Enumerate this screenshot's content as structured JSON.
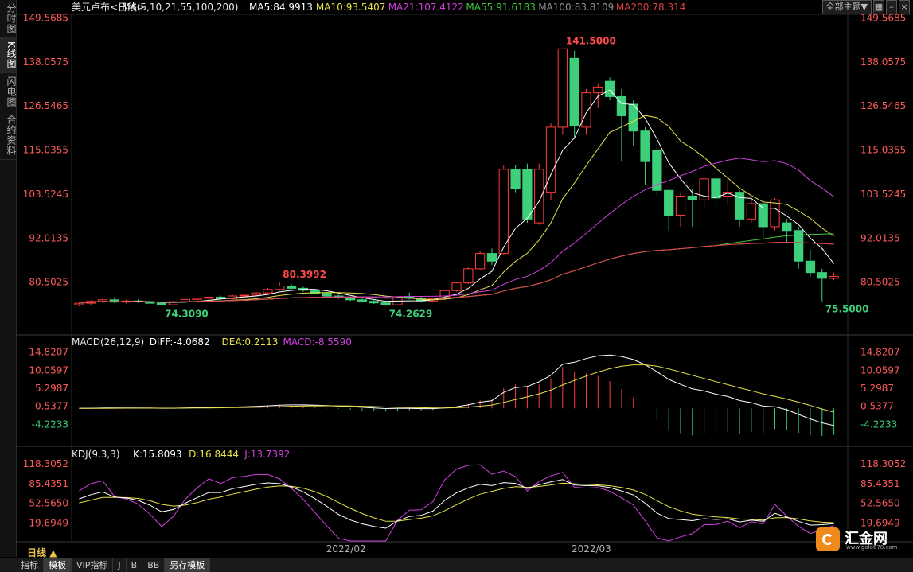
{
  "sidebar": {
    "tabs": [
      {
        "label": "分时图",
        "active": false
      },
      {
        "label": "K线图",
        "active": true
      },
      {
        "label": "闪电图",
        "active": false
      },
      {
        "label": "合约资料",
        "active": false
      }
    ]
  },
  "topbar": {
    "theme_button": "全部主题▼",
    "icons": [
      "grid-icon",
      "minimize-icon",
      "close-icon"
    ]
  },
  "colors": {
    "up": "#ff3b3b",
    "down": "#3cd07a",
    "ma5": "#ffffff",
    "ma10": "#e8e14a",
    "ma21": "#d040e0",
    "ma55": "#3ec83e",
    "ma100": "#909090",
    "ma200": "#e04040",
    "price_axis": "#ff5a5a",
    "neg_axis": "#3cd07a"
  },
  "bottom": {
    "period": "日线",
    "tabs": [
      "指标",
      "模板",
      "VIP指标",
      "J",
      "B",
      "BB",
      "另存模板"
    ],
    "active": [
      "模板",
      "另存模板"
    ]
  },
  "logo": {
    "name": "汇金网",
    "url": "www.gold678.com"
  },
  "chart_data": [
    {
      "type": "candlestick",
      "title": "美元卢布<日线>",
      "legend": [
        {
          "text": "美元卢布<日线>",
          "color": "#e8e8e8"
        },
        {
          "text": "MA(5,10,21,55,100,200)",
          "color": "#e8e8e8"
        },
        {
          "text": "MA5:84.9913",
          "color": "#ffffff"
        },
        {
          "text": "MA10:93.5407",
          "color": "#e8e14a"
        },
        {
          "text": "MA21:107.4122",
          "color": "#d040e0"
        },
        {
          "text": "MA55:91.6183",
          "color": "#3ec83e"
        },
        {
          "text": "MA100:83.8109",
          "color": "#909090"
        },
        {
          "text": "MA200:78.314",
          "color": "#e04040"
        }
      ],
      "y_ticks": [
        "149.5685",
        "138.0575",
        "126.5465",
        "115.0355",
        "103.5245",
        "92.0135",
        "80.5025"
      ],
      "ylim": [
        69.0,
        150.5
      ],
      "annotations": [
        {
          "text": "80.3992",
          "value": 80.3992,
          "color": "#ff4a4a"
        },
        {
          "text": "74.3090",
          "value": 74.309,
          "color": "#3cd07a"
        },
        {
          "text": "74.2629",
          "value": 74.2629,
          "color": "#3cd07a"
        },
        {
          "text": "141.5000",
          "value": 141.5,
          "color": "#ff4a4a"
        },
        {
          "text": "75.5000",
          "value": 75.5,
          "color": "#3cd07a"
        }
      ],
      "x_labels": [
        "2022/02",
        "2022/03"
      ],
      "candles": [
        [
          74.6,
          75.2,
          74.2,
          75.0
        ],
        [
          75.0,
          75.8,
          74.5,
          75.5
        ],
        [
          75.5,
          76.3,
          75.1,
          75.9
        ],
        [
          75.9,
          76.6,
          75.0,
          75.3
        ],
        [
          75.3,
          76.0,
          74.9,
          75.6
        ],
        [
          75.6,
          76.0,
          75.1,
          75.4
        ],
        [
          75.4,
          75.9,
          74.8,
          75.0
        ],
        [
          75.0,
          75.4,
          74.3,
          74.6
        ],
        [
          74.6,
          75.6,
          74.4,
          75.4
        ],
        [
          75.4,
          76.2,
          75.1,
          76.0
        ],
        [
          76.0,
          76.8,
          75.6,
          76.3
        ],
        [
          76.3,
          76.9,
          75.9,
          76.6
        ],
        [
          76.6,
          77.0,
          76.0,
          76.2
        ],
        [
          76.2,
          77.2,
          75.9,
          76.9
        ],
        [
          76.9,
          77.5,
          76.5,
          77.1
        ],
        [
          77.1,
          78.0,
          76.8,
          77.7
        ],
        [
          77.7,
          79.0,
          77.3,
          78.6
        ],
        [
          78.6,
          80.4,
          78.2,
          79.5
        ],
        [
          79.5,
          80.0,
          78.5,
          78.9
        ],
        [
          78.9,
          79.3,
          78.0,
          78.4
        ],
        [
          78.4,
          78.7,
          77.3,
          77.6
        ],
        [
          77.6,
          77.9,
          76.6,
          76.9
        ],
        [
          76.9,
          77.2,
          76.1,
          76.4
        ],
        [
          76.4,
          76.8,
          75.6,
          75.9
        ],
        [
          75.9,
          76.3,
          75.2,
          75.5
        ],
        [
          75.5,
          75.8,
          74.8,
          75.1
        ],
        [
          75.1,
          75.4,
          74.3,
          74.6
        ],
        [
          74.6,
          76.8,
          74.4,
          76.7
        ],
        [
          76.7,
          77.8,
          76.0,
          76.3
        ],
        [
          76.3,
          76.9,
          75.4,
          75.6
        ],
        [
          75.6,
          76.5,
          75.3,
          76.2
        ],
        [
          76.2,
          78.6,
          75.8,
          78.3
        ],
        [
          78.3,
          80.6,
          78.0,
          80.3
        ],
        [
          80.3,
          84.5,
          80.0,
          84.0
        ],
        [
          84.0,
          88.6,
          83.6,
          88.0
        ],
        [
          88.0,
          89.3,
          85.0,
          86.0
        ],
        [
          88.0,
          111.0,
          87.5,
          110.0
        ],
        [
          110.0,
          111.0,
          104.0,
          105.0
        ],
        [
          110.0,
          111.5,
          96.0,
          97.0
        ],
        [
          96.0,
          111.5,
          95.5,
          110.0
        ],
        [
          104.0,
          122.0,
          102.0,
          121.0
        ],
        [
          121.0,
          141.5,
          119.0,
          141.5
        ],
        [
          139.0,
          141.0,
          118.0,
          121.5
        ],
        [
          121.0,
          131.0,
          119.0,
          130.0
        ],
        [
          130.0,
          132.5,
          126.0,
          131.5
        ],
        [
          133.0,
          134.0,
          128.0,
          129.0
        ],
        [
          129.0,
          131.0,
          112.0,
          124.0
        ],
        [
          127.0,
          128.0,
          116.0,
          120.0
        ],
        [
          120.0,
          121.0,
          106.0,
          112.0
        ],
        [
          115.0,
          117.0,
          103.0,
          104.5
        ],
        [
          104.5,
          105.0,
          94.0,
          98.0
        ],
        [
          98.0,
          104.0,
          95.0,
          103.0
        ],
        [
          103.0,
          105.0,
          95.0,
          102.0
        ],
        [
          102.0,
          108.0,
          100.0,
          107.5
        ],
        [
          107.5,
          108.0,
          100.0,
          102.5
        ],
        [
          103.0,
          108.0,
          101.0,
          104.0
        ],
        [
          104.0,
          104.5,
          95.0,
          97.0
        ],
        [
          97.0,
          102.0,
          96.0,
          101.0
        ],
        [
          101.0,
          102.0,
          92.0,
          95.0
        ],
        [
          95.0,
          102.5,
          94.0,
          102.0
        ],
        [
          96.0,
          97.0,
          91.0,
          94.0
        ],
        [
          94.0,
          95.0,
          84.0,
          86.0
        ],
        [
          86.0,
          89.0,
          82.0,
          83.0
        ],
        [
          83.0,
          84.0,
          75.5,
          81.5
        ],
        [
          81.5,
          83.0,
          81.0,
          82.0
        ]
      ]
    },
    {
      "type": "line",
      "title": "MACD(26,12,9)",
      "legend": [
        {
          "text": "MACD(26,12,9)",
          "color": "#e8e8e8"
        },
        {
          "text": "DIFF:-4.0682",
          "color": "#ffffff"
        },
        {
          "text": "DEA:0.2113",
          "color": "#e8e14a"
        },
        {
          "text": "MACD:-8.5590",
          "color": "#d040e0"
        }
      ],
      "y_ticks": [
        "14.8207",
        "10.0597",
        "5.2987",
        "0.5377",
        "-4.2233"
      ],
      "ylim": [
        -9.8,
        15.8
      ]
    },
    {
      "type": "line",
      "title": "KDJ(9,3,3)",
      "legend": [
        {
          "text": "KDJ(9,3,3)",
          "color": "#e8e8e8"
        },
        {
          "text": "K:15.8093",
          "color": "#ffffff"
        },
        {
          "text": "D:16.8444",
          "color": "#e8e14a"
        },
        {
          "text": "J:13.7392",
          "color": "#d040e0"
        }
      ],
      "y_ticks": [
        "118.3052",
        "85.4351",
        "52.5650",
        "19.6949"
      ],
      "ylim": [
        -10,
        125
      ]
    }
  ]
}
